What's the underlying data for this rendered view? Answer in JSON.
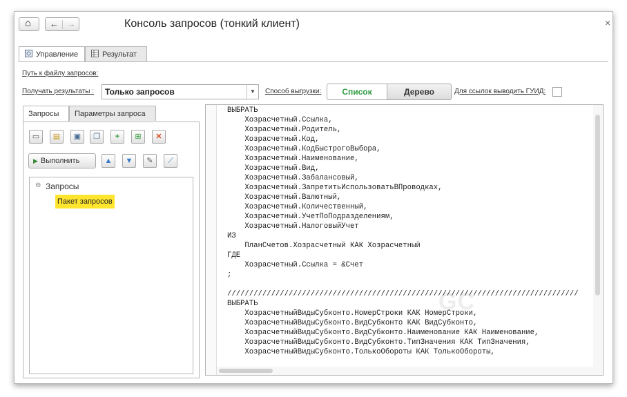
{
  "window": {
    "title": "Консоль запросов (тонкий клиент)",
    "close_glyph": "×",
    "home_glyph": "⌂",
    "back_glyph": "←",
    "forward_glyph": "→"
  },
  "tabs": [
    {
      "label": "Управление",
      "icon": "gear-doc-icon",
      "active": true
    },
    {
      "label": "Результат",
      "icon": "table-icon",
      "active": false
    }
  ],
  "form": {
    "path_link": "Путь к файлу запросов:",
    "results_label": "Получать результаты :",
    "results_value": "Только запросов",
    "results_arrow": "▼",
    "export_label": "Способ выгрузки:",
    "export_options": [
      "Список",
      "Дерево"
    ],
    "export_selected": "Список",
    "guid_label": "Для ссылок выводить ГУИД:",
    "guid_checked": false
  },
  "left_tabs": [
    {
      "label": "Запросы",
      "active": true
    },
    {
      "label": "Параметры запроса",
      "active": false
    }
  ],
  "toolbar": {
    "row1_icons": [
      "new-icon",
      "open-folder-icon",
      "save-icon",
      "save-as-icon",
      "add-icon",
      "copy-icon",
      "delete-icon"
    ],
    "run_label": "Выполнить",
    "run_glyph": "▶",
    "row2_icons": [
      "move-up-icon",
      "move-down-icon",
      "edit-query-icon",
      "query-wizard-icon"
    ],
    "glyphs": {
      "new": "▭",
      "open": "▤",
      "save": "▣",
      "save_as": "❐",
      "add": "+",
      "copy": "⊞",
      "delete": "✕",
      "up": "▲",
      "down": "▼",
      "edit": "✎",
      "wizard": "⟋"
    }
  },
  "tree": {
    "expand_glyph": "⊖",
    "root": "Запросы",
    "child": "Пакет запросов"
  },
  "editor": {
    "watermark": "GC",
    "code": "ВЫБРАТЬ\n    Хозрасчетный.Ссылка,\n    Хозрасчетный.Родитель,\n    Хозрасчетный.Код,\n    Хозрасчетный.КодБыстрогоВыбора,\n    Хозрасчетный.Наименование,\n    Хозрасчетный.Вид,\n    Хозрасчетный.Забалансовый,\n    Хозрасчетный.ЗапретитьИспользоватьВПроводках,\n    Хозрасчетный.Валютный,\n    Хозрасчетный.Количественный,\n    Хозрасчетный.УчетПоПодразделениям,\n    Хозрасчетный.НалоговыйУчет\nИЗ\n    ПланСчетов.Хозрасчетный КАК Хозрасчетный\nГДЕ\n    Хозрасчетный.Ссылка = &Счет\n;\n\n////////////////////////////////////////////////////////////////////////////////\nВЫБРАТЬ\n    ХозрасчетныйВидыСубконто.НомерСтроки КАК НомерСтроки,\n    ХозрасчетныйВидыСубконто.ВидСубконто КАК ВидСубконто,\n    ХозрасчетныйВидыСубконто.ВидСубконто.Наименование КАК Наименование,\n    ХозрасчетныйВидыСубконто.ВидСубконто.ТипЗначения КАК ТипЗначения,\n    ХозрасчетныйВидыСубконто.ТолькоОбороты КАК ТолькоОбороты,"
  },
  "colors": {
    "accent_green": "#2e9a3e",
    "highlight_yellow": "#ffe52e",
    "border": "#b5b5b5"
  }
}
